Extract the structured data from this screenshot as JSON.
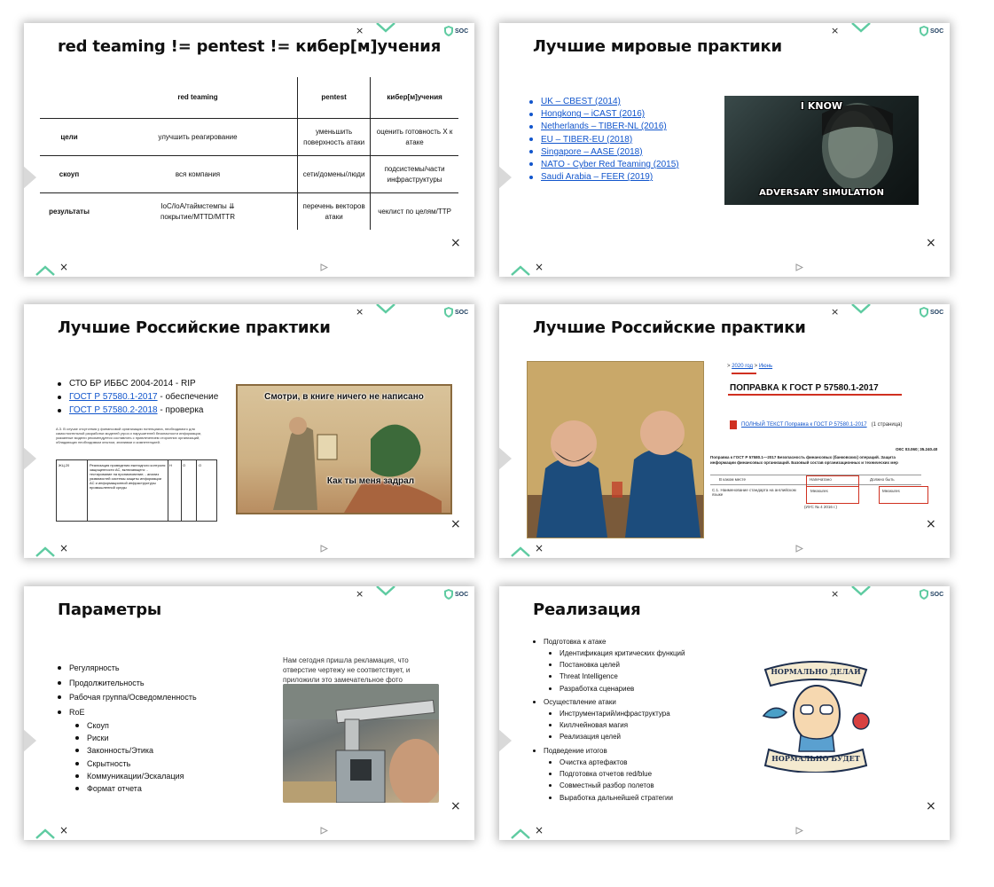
{
  "brand": {
    "logo_text": "SOC",
    "close_glyph": "×",
    "accent_color": "#5ecba1",
    "link_color": "#1155cc"
  },
  "slide1": {
    "title": "red teaming != pentest != кибер[м]учения",
    "table": {
      "headers": [
        "",
        "red teaming",
        "pentest",
        "кибер[м]учения"
      ],
      "rows": [
        [
          "цели",
          "улучшить реагирование",
          "уменьшить поверхность атаки",
          "оценить готовность Х к атаке"
        ],
        [
          "скоуп",
          "вся компания",
          "сети/домены/люди",
          "подсистемы/части инфраструктуры"
        ],
        [
          "результаты",
          "IoC/IoA/таймстемпы ⇊ покрытие/MTTD/MTTR",
          "перечень векторов атаки",
          "чеклист по целям/TTP"
        ]
      ]
    }
  },
  "slide2": {
    "title": "Лучшие мировые практики",
    "links": [
      "UK – CBEST (2014)",
      "Hongkong – iCAST (2016)",
      "Netherlands – TIBER-NL (2016)",
      "EU – TIBER-EU (2018)",
      "Singapore – AASE (2018)",
      "NATO - Cyber Red Teaming (2015)",
      "Saudi Arabia – FEER (2019)"
    ],
    "meme": {
      "top": "I KNOW",
      "bottom": "ADVERSARY SIMULATION"
    }
  },
  "slide3": {
    "title": "Лучшие Российские практики",
    "items": [
      {
        "link": "",
        "text": "СТО БР ИББС 2004-2014 - RIP"
      },
      {
        "link": "ГОСТ Р 57580.1-2017",
        "text": " - обеспечение"
      },
      {
        "link": "ГОСТ Р 57580.2-2018",
        "text": " - проверка"
      }
    ],
    "paragraph": "А.3. В случае отсутствия у финансовой организации потенциала, необходимого для самостоятельной разработки моделей угроз и нарушителей безопасности информации, указанные модели рекомендуется составлять с привлечением сторонних организаций, обладающих необходимым опытом, знаниями и компетенцией.",
    "table_row": {
      "code": "ЖЦ.20",
      "desc": "Реализация проведения ежегодного контроля защищенности АС, включающего: - тестирование на проникновение; - анализ уязвимостей системы защиты информации АС и информационной инфраструктуры промышленной среды",
      "c1": "Н",
      "c2": "О",
      "c3": "О"
    },
    "meme": {
      "top": "Смотри, в книге ничего не написано",
      "bottom": "Как ты меня задрал"
    }
  },
  "slide4": {
    "title": "Лучшие Российские практики",
    "breadcrumb": {
      "sep": ">",
      "year": "2020 год",
      "month": "Июнь"
    },
    "amend_title": "ПОПРАВКА К ГОСТ Р 57580.1-2017",
    "doc_link": "ПОЛНЫЙ ТЕКСТ Поправка к ГОСТ Р 57580.1-2017",
    "doc_pages": "(1 страница)",
    "oks": "ОКС 03.060; 35.240.40",
    "desc": "Поправка к ГОСТ Р 57580.1—2017 Безопасность финансовых (банковских) операций. Защита информации финансовых организаций. Базовый состав организационных и технических мер",
    "table": {
      "h1": "В каком месте",
      "h2": "Напечатано",
      "h3": "Должно быть",
      "c1": "С.1. Наименование стандарта на английском языке",
      "c2": "Measures",
      "c3": "Measures",
      "footer": "(ИУС № 4 2016 г.)"
    }
  },
  "slide5": {
    "title": "Параметры",
    "items": [
      "Регулярность",
      "Продолжительность",
      "Рабочая группа/Осведомленность",
      "RoE"
    ],
    "roe_items": [
      "Скоуп",
      "Риски",
      "Законность/Этика",
      "Скрытность",
      "Коммуникации/Эскалация",
      "Формат отчета"
    ],
    "quote": "Нам сегодня пришла рекламация, что отверстие чертежу не соответствует, и приложили это замечательное фото"
  },
  "slide6": {
    "title": "Реализация",
    "sections": [
      {
        "label": "Подготовка к атаке",
        "items": [
          "Идентификация критических функций",
          "Постановка целей",
          "Threat Intelligence",
          "Разработка сценариев"
        ]
      },
      {
        "label": "Осуществление атаки",
        "items": [
          "Инструментарий/инфраструктура",
          "Киллчейновая магия",
          "Реализация целей"
        ]
      },
      {
        "label": "Подведение итогов",
        "items": [
          "Очистка артефактов",
          "Подготовка отчетов red/blue",
          "Совместный разбор полетов",
          "Выработка дальнейшей стратегии"
        ]
      }
    ],
    "sticker": {
      "top": "НОРМАЛЬНО ДЕЛАЙ",
      "bottom": "НОРМАЛЬНО БУДЕТ"
    }
  }
}
